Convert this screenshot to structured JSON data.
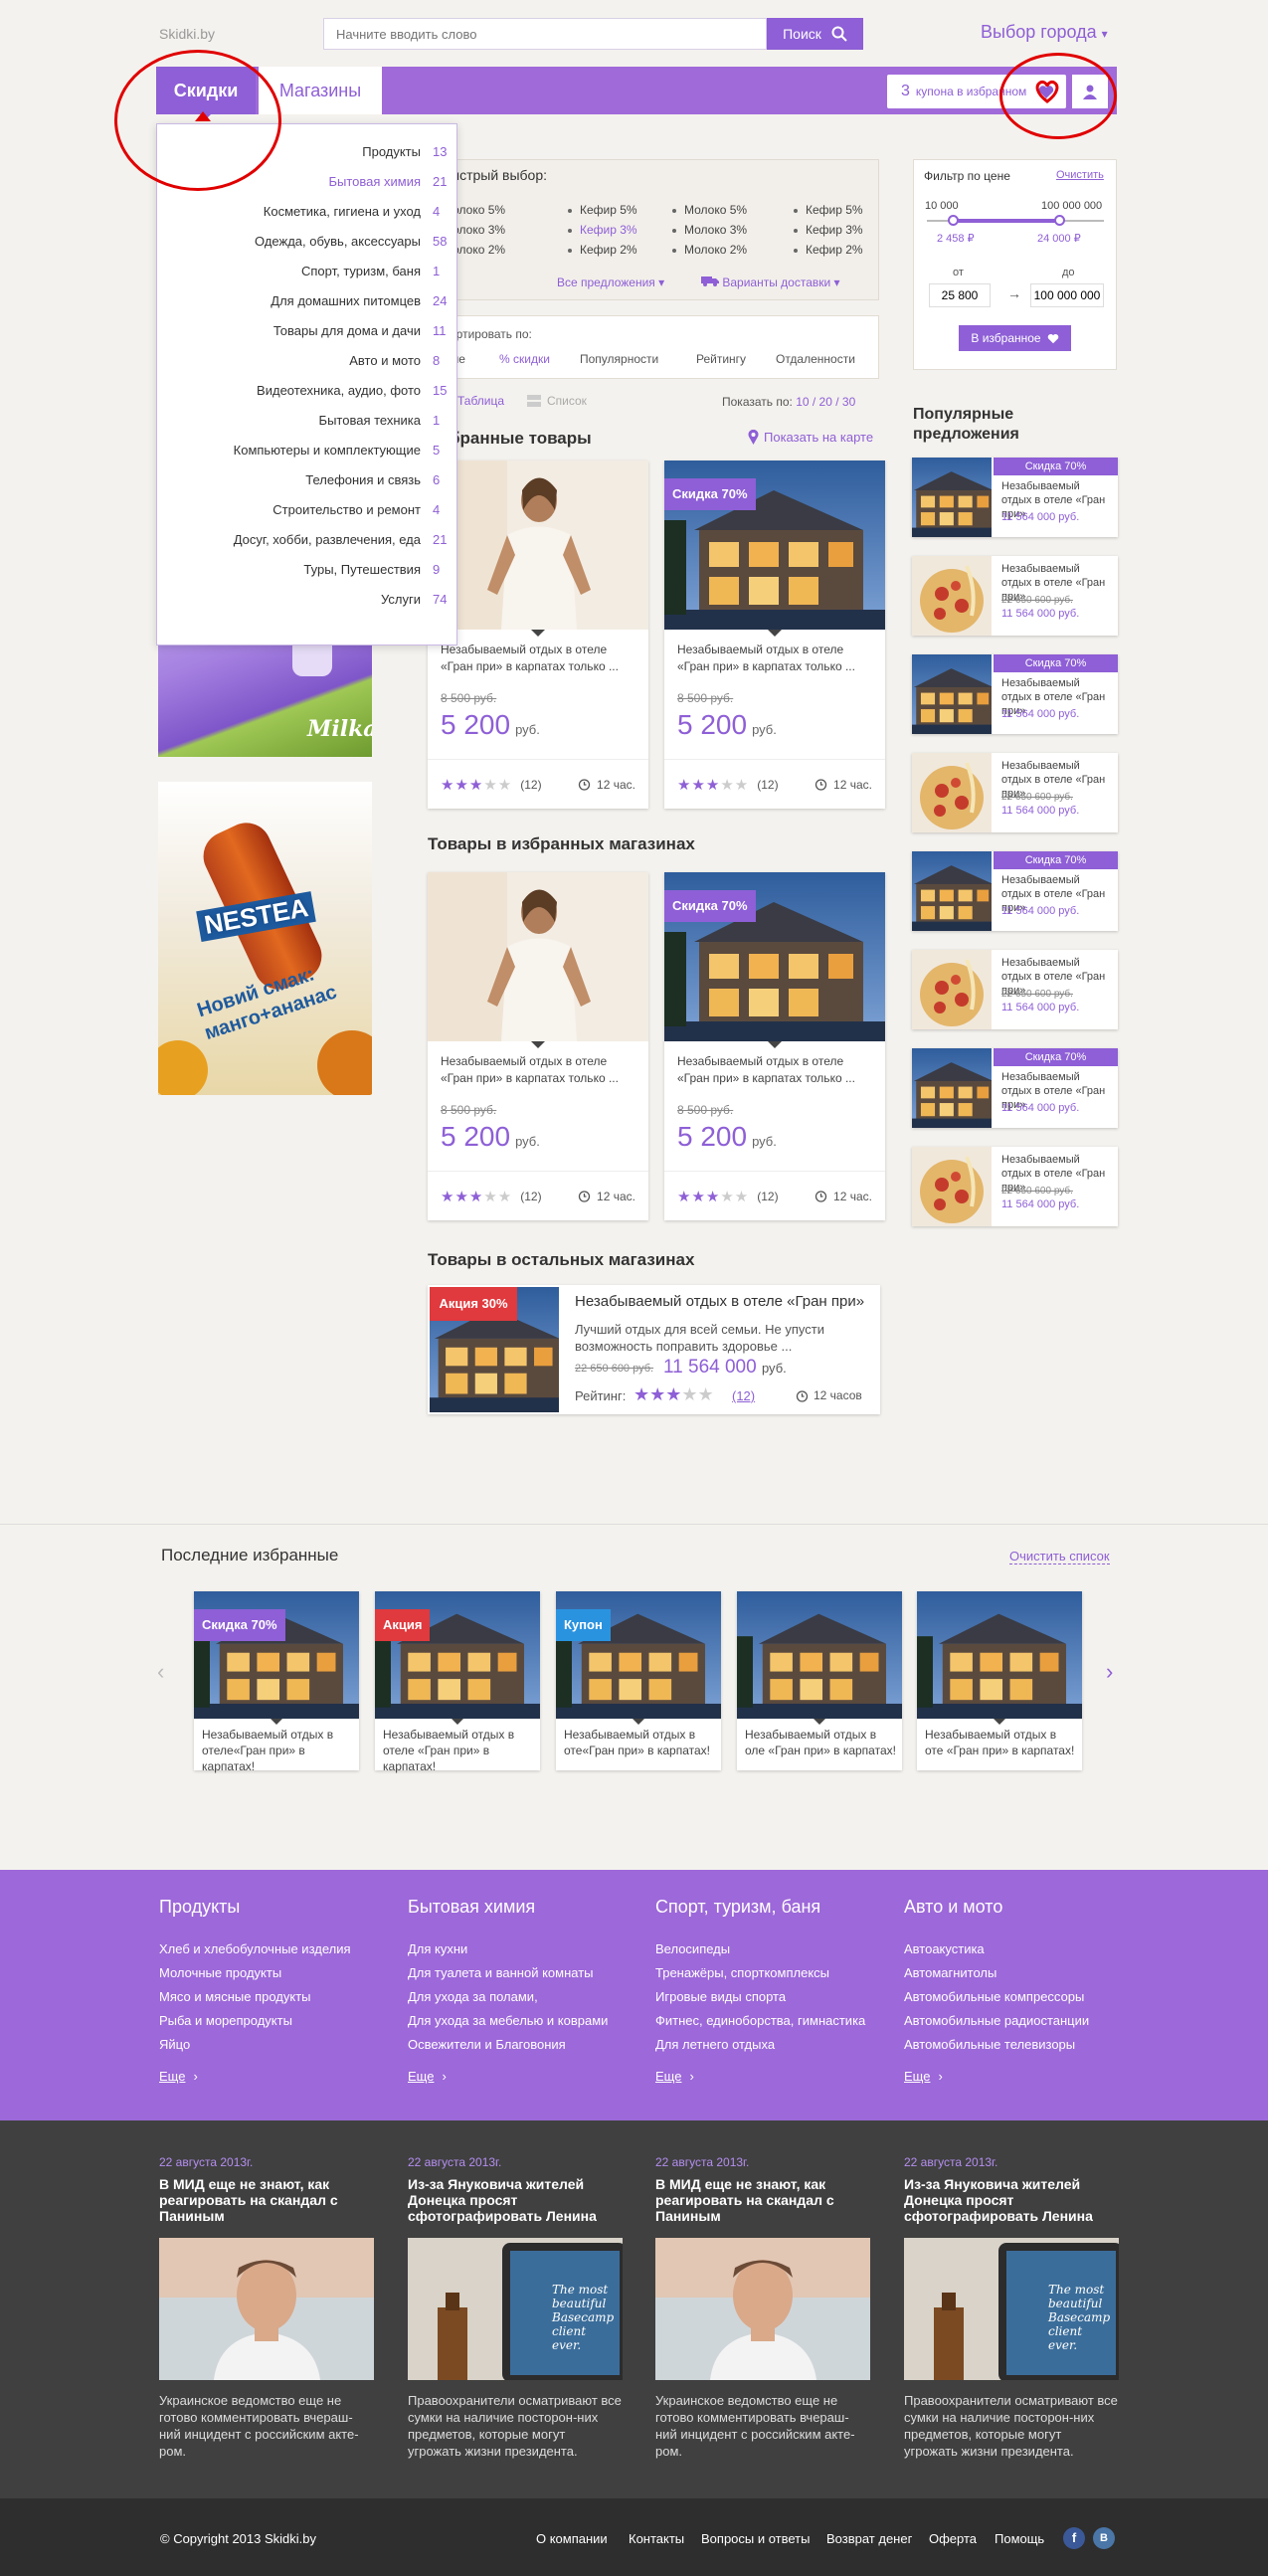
{
  "header": {
    "logo": "Skidki.by",
    "search_placeholder": "Начните вводить слово",
    "search_button": "Поиск",
    "city": "Выбор города"
  },
  "nav": {
    "tab_discounts": "Скидки",
    "tab_shops": "Магазины",
    "fav_count": "3",
    "fav_text": "купона в избранном"
  },
  "categories": [
    {
      "label": "Продукты",
      "count": "13"
    },
    {
      "label": "Бытовая химия",
      "count": "21"
    },
    {
      "label": "Косметика, гигиена и уход",
      "count": "4"
    },
    {
      "label": "Одежда, обувь, аксессуары",
      "count": "58"
    },
    {
      "label": "Спорт, туризм, баня",
      "count": "1"
    },
    {
      "label": "Для домашних питомцев",
      "count": "24"
    },
    {
      "label": "Товары для дома и дачи",
      "count": "11"
    },
    {
      "label": "Авто и мото",
      "count": "8"
    },
    {
      "label": "Видеотехника, аудио, фото",
      "count": "15"
    },
    {
      "label": "Бытовая техника",
      "count": "1"
    },
    {
      "label": "Компьютеры и комплектующие",
      "count": "5"
    },
    {
      "label": "Телефония и связь",
      "count": "6"
    },
    {
      "label": "Строительство и ремонт",
      "count": "4"
    },
    {
      "label": "Досуг, хобби, развлечения, еда",
      "count": "21"
    },
    {
      "label": "Туры, Путешествия",
      "count": "9"
    },
    {
      "label": "Услуги",
      "count": "74"
    }
  ],
  "quick": {
    "title": "ыстрый выбор:",
    "items": [
      "Молоко 5%",
      "Кефир 5%",
      "Молоко 5%",
      "Кефир 5%",
      "Молоко 3%",
      "Кефир 3%",
      "Молоко 3%",
      "Кефир 3%",
      "Молоко 2%",
      "Кефир 2%",
      "Молоко 2%",
      "Кефир 2%"
    ],
    "all_offers": "Все предложения",
    "delivery": "Варианты доставки"
  },
  "sort": {
    "label": "ортировать по:",
    "opts": [
      "ене",
      "% скидки",
      "Популярности",
      "Рейтингу",
      "Отдаленности"
    ],
    "table": "Таблица",
    "list": "Список",
    "show": "Показать по:",
    "show_opts": "10 / 20 / 30"
  },
  "filter": {
    "title": "Фильтр по цене",
    "clear": "Очистить",
    "min": "10 000",
    "max": "100 000 000",
    "sel_min": "2 458 ₽",
    "sel_max": "24 000 ₽",
    "from": "от",
    "to": "до",
    "from_val": "25 800",
    "to_val": "100 000 000",
    "fav_btn": "В избранное"
  },
  "sections": {
    "fav_goods": "збранные товары",
    "show_map": "Показать на карте",
    "fav_shops": "Товары в избранных магазинах",
    "other_shops": "Товары в остальных магазинах",
    "popular": "Популярные предложения",
    "recent": "Последние избранные",
    "clear_list": "Очистить список"
  },
  "product": {
    "desc": "Незабываемый отдых в отеле «Гран при» в карпатах только ...",
    "old": "8 500 руб.",
    "price": "5 200",
    "rub": "руб.",
    "reviews": "(12)",
    "time": "12 час.",
    "badge": "Скидка 70%"
  },
  "wide": {
    "badge": "Акция 30%",
    "title": "Незабываемый отдых в отеле «Гран при»",
    "desc": "Лучший отдых для всей семьи. Не упусти возможность поправить здоровье ...",
    "old": "22 650 600 руб.",
    "price": "11 564 000",
    "rub": "руб.",
    "rating": "Рейтинг:",
    "reviews": "(12)",
    "time": "12 часов"
  },
  "popular": {
    "badge": "Скидка 70%",
    "title": "Незабываемый отдых в отеле «Гран при»",
    "old": "22 650 600 руб.",
    "price": "11 564 000 руб."
  },
  "recent": [
    {
      "badge": "Скидка 70%",
      "color": "#8e5fd6",
      "text": "Незабываемый отдых в отеле«Гран при» в карпатах!"
    },
    {
      "badge": "Акция",
      "color": "#e0393e",
      "text": "Незабываемый отдых в отеле «Гран при» в карпатах!"
    },
    {
      "badge": "Купон",
      "color": "#2a93e0",
      "text": "Незабываемый отдых в оте«Гран при» в карпатах!"
    },
    {
      "badge": "",
      "color": "",
      "text": "Незабываемый отдых в оле «Гран при» в карпатах!"
    },
    {
      "badge": "",
      "color": "",
      "text": "Незабываемый отдых в оте «Гран при» в карпатах!"
    }
  ],
  "footer_cats": [
    {
      "title": "Продукты",
      "links": [
        "Хлеб и хлебобулочные изделия",
        "Молочные продукты",
        "Мясо и мясные продукты",
        "Рыба и морепродукты",
        "Яйцо"
      ]
    },
    {
      "title": "Бытовая химия",
      "links": [
        "Для кухни",
        "Для туалета и ванной комнаты",
        "Для ухода за полами,",
        "Для ухода за мебелью и коврами",
        "Освежители и Благовония"
      ]
    },
    {
      "title": "Спорт, туризм, баня",
      "links": [
        "Велосипеды",
        "Тренажёры, спорткомплексы",
        "Игровые виды спорта",
        "Фитнес, единоборства, гимнастика",
        "Для летнего отдыха"
      ]
    },
    {
      "title": "Авто и мото",
      "links": [
        "Автоакустика",
        "Автомагнитолы",
        "Автомобильные компрессоры",
        "Автомобильные радиостанции",
        "Автомобильные телевизоры"
      ]
    }
  ],
  "more": "Еще",
  "news": [
    {
      "date": "22 августа 2013г.",
      "title": "В МИД еще не знают, как реагировать на скандал с Паниным",
      "text": "Украинское ведомство еще не готово комментировать вчераш-ний инцидент с российским акте-ром."
    },
    {
      "date": "22 августа 2013г.",
      "title": "Из-за Януковича жителей Донецка просят сфотографировать Ленина",
      "text": "Правоохранители осматривают все сумки на наличие посторон-них предметов, которые могут угрожать жизни президента."
    },
    {
      "date": "22 августа 2013г.",
      "title": "В МИД еще не знают, как реагировать на скандал с Паниным",
      "text": "Украинское ведомство еще не готово комментировать вчераш-ний инцидент с российским акте-ром."
    },
    {
      "date": "22 августа 2013г.",
      "title": "Из-за Януковича жителей Донецка просят сфотографировать Ленина",
      "text": "Правоохранители осматривают все сумки на наличие посторон-них предметов, которые могут угрожать жизни президента."
    }
  ],
  "ipad_text": "The most beautiful Basecamp client ever.",
  "ads": {
    "milka": "Milka",
    "nestea": "NESTEA",
    "nestea_slogan": "Новий смак: манго+ананас"
  },
  "bottom": {
    "copyright": "© Copyright 2013 Skidki.by",
    "links": [
      "О компании",
      "Контакты",
      "Вопросы и ответы",
      "Возврат денег",
      "Оферта",
      "Помощь"
    ],
    "fb": "f",
    "vk": "B"
  },
  "colors": {
    "accent": "#8e5fd6",
    "nav": "#a06ad9",
    "footer": "#9d68d9",
    "dark": "#404040",
    "annotation": "#e00000"
  }
}
